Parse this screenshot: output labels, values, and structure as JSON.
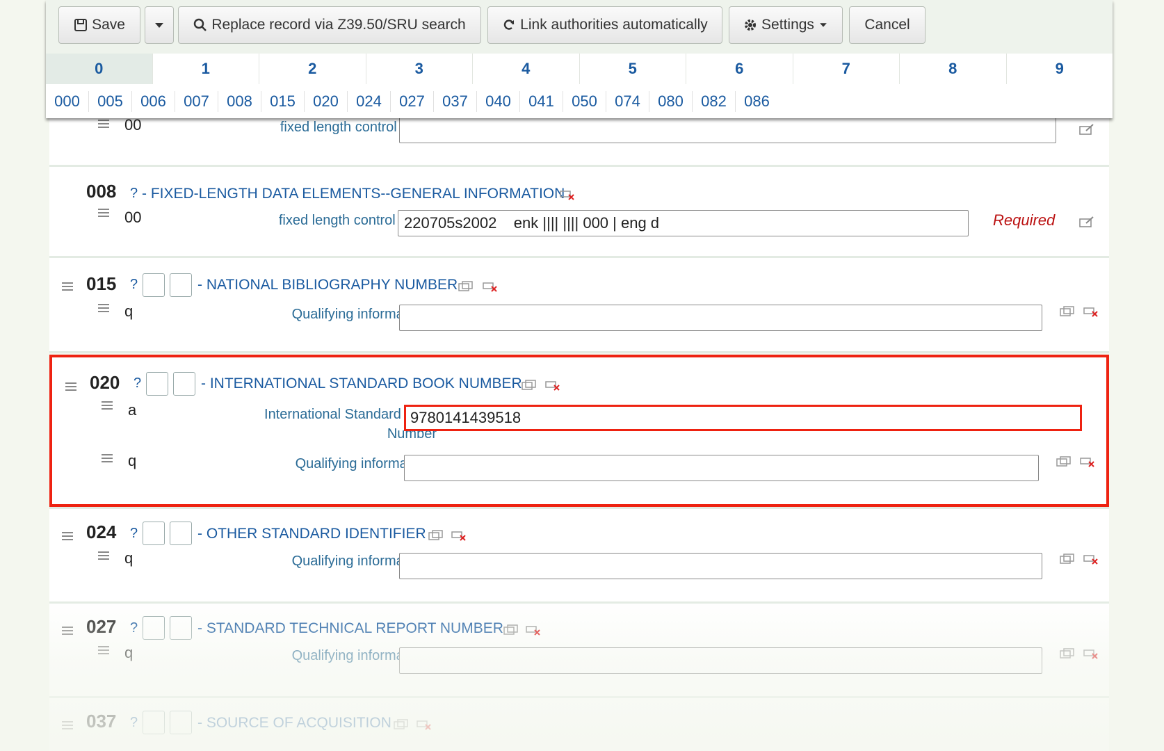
{
  "toolbar": {
    "save_label": "Save",
    "replace_label": "Replace record via Z39.50/SRU search",
    "link_label": "Link authorities automatically",
    "settings_label": "Settings",
    "cancel_label": "Cancel"
  },
  "tabs": [
    "0",
    "1",
    "2",
    "3",
    "4",
    "5",
    "6",
    "7",
    "8",
    "9"
  ],
  "active_tab": "0",
  "subtabs": [
    "000",
    "005",
    "006",
    "007",
    "008",
    "015",
    "020",
    "024",
    "027",
    "037",
    "040",
    "041",
    "050",
    "074",
    "080",
    "082",
    "086"
  ],
  "fields": {
    "f006_partial": {
      "subcode": "00",
      "label": "fixed length control field",
      "value": ""
    },
    "f008": {
      "tag": "008",
      "qmark": "?",
      "title": "- FIXED-LENGTH DATA ELEMENTS--GENERAL INFORMATION",
      "subcode": "00",
      "label": "fixed length control field",
      "value": "220705s2002    enk |||| |||| 000 | eng d",
      "required": "Required"
    },
    "f015": {
      "tag": "015",
      "qmark": "?",
      "title": "- NATIONAL BIBLIOGRAPHY NUMBER",
      "subcode": "q",
      "label": "Qualifying information",
      "value": ""
    },
    "f020": {
      "tag": "020",
      "qmark": "?",
      "title": "- INTERNATIONAL STANDARD BOOK NUMBER",
      "sub_a_code": "a",
      "sub_a_label_1": "International Standard Book",
      "sub_a_label_2": "Number",
      "sub_a_value": "9780141439518",
      "sub_q_code": "q",
      "sub_q_label": "Qualifying information",
      "sub_q_value": ""
    },
    "f024": {
      "tag": "024",
      "qmark": "?",
      "title": "- OTHER STANDARD IDENTIFIER",
      "subcode": "q",
      "label": "Qualifying information",
      "value": ""
    },
    "f027": {
      "tag": "027",
      "qmark": "?",
      "title": "- STANDARD TECHNICAL REPORT NUMBER",
      "subcode": "q",
      "label": "Qualifying information",
      "value": ""
    },
    "f037": {
      "tag": "037",
      "qmark": "?",
      "title": "- SOURCE OF ACQUISITION"
    }
  },
  "colors": {
    "link": "#1a5aa0",
    "label": "#2a6b96",
    "required": "#bb1111",
    "highlight": "#ee2211"
  }
}
